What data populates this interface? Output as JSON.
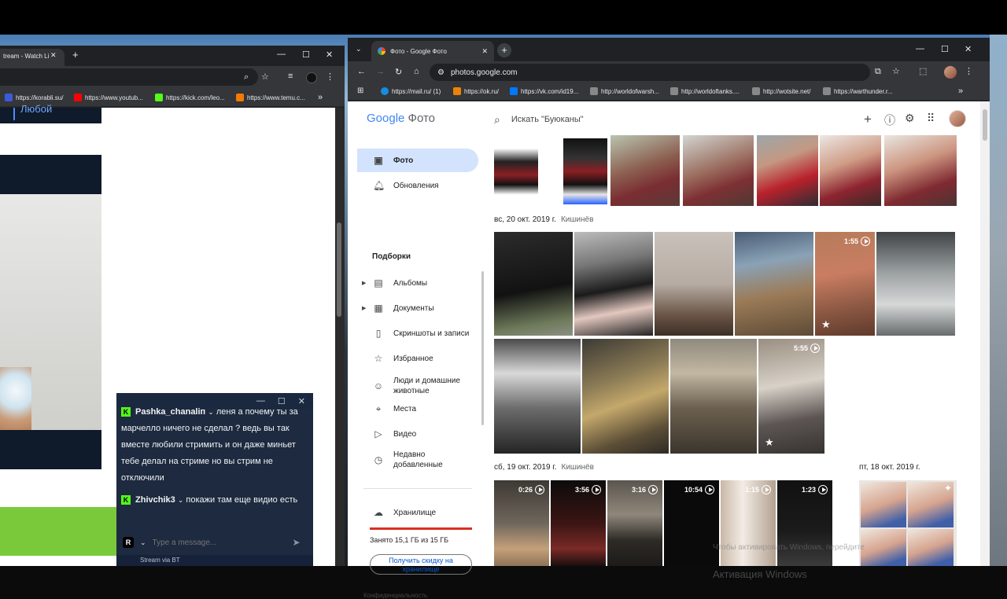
{
  "left_window": {
    "tab_title": "tream - Watch Li",
    "bookmarks": [
      {
        "label": "https://korabli.su/",
        "color": "#3b5bdb"
      },
      {
        "label": "https://www.youtub...",
        "color": "#ff0000"
      },
      {
        "label": "https://kick.com/leo...",
        "color": "#53fc18"
      },
      {
        "label": "https://www.temu.c...",
        "color": "#f27b00"
      }
    ],
    "page_fragment_text": "Любой",
    "chat": {
      "messages": [
        {
          "user": "Pashka_chanaliп",
          "text": "леня а почему ты за марчелло ничего не сделал ? ведь вы так вместе любили стримить и он даже миньет тебе делал на стриме но вы стрим не отключили"
        },
        {
          "user": "Zhivchik3",
          "text": "покажи там еще видио есть"
        }
      ],
      "input_placeholder": "Type a message...",
      "avatar_letter": "R",
      "footer_label": "Stream via BT"
    }
  },
  "right_window": {
    "tab_title": "Фото - Google Фото",
    "url": "photos.google.com",
    "bookmarks": [
      {
        "label": "https://mail.ru/ (1)",
        "color": "#168de2"
      },
      {
        "label": "https://ok.ru/",
        "color": "#ee8208"
      },
      {
        "label": "https://vk.com/id19...",
        "color": "#0077ff"
      },
      {
        "label": "http://worldofwarsh...",
        "color": "#888888"
      },
      {
        "label": "http://worldoftanks....",
        "color": "#888888"
      },
      {
        "label": "http://wotsite.net/",
        "color": "#888888"
      },
      {
        "label": "https://warthunder.r...",
        "color": "#888888"
      }
    ]
  },
  "photos_app": {
    "logo_google": "Google",
    "logo_photos": "Фото",
    "search_placeholder": "Искать \"Буюканы\"",
    "nav": [
      {
        "label": "Фото",
        "icon": "photo-icon",
        "active": true
      },
      {
        "label": "Обновления",
        "icon": "bell-icon",
        "active": false
      }
    ],
    "collections_title": "Подборки",
    "collections": [
      {
        "label": "Альбомы",
        "icon": "album-icon",
        "caret": true
      },
      {
        "label": "Документы",
        "icon": "document-icon",
        "caret": true
      },
      {
        "label": "Скриншоты и записи",
        "icon": "screenshot-icon",
        "caret": false
      },
      {
        "label": "Избранное",
        "icon": "star-icon",
        "caret": false
      },
      {
        "label": "Люди и домашние животные",
        "icon": "people-icon",
        "caret": false
      },
      {
        "label": "Места",
        "icon": "place-icon",
        "caret": false
      },
      {
        "label": "Видео",
        "icon": "video-icon",
        "caret": false
      },
      {
        "label": "Недавно добавленные",
        "icon": "recent-icon",
        "caret": false
      }
    ],
    "storage": {
      "label": "Хранилище",
      "used_text": "Занято 15,1 ГБ из 15 ГБ",
      "used_fraction": 1.0,
      "discount_button": "Получить скидку на хранилище"
    },
    "footer_link": "Конфиденциальность",
    "groups": [
      {
        "date": "вс, 20 окт. 2019 г.",
        "location": "Кишинёв"
      },
      {
        "date": "сб, 19 окт. 2019 г.",
        "location": "Кишинёв"
      },
      {
        "date": "пт, 18 окт. 2019 г.",
        "location": ""
      }
    ],
    "video_durations": {
      "row1": "1:55",
      "row2": "5:55",
      "row3": [
        "0:26",
        "3:56",
        "3:16",
        "10:54",
        "1:15",
        "1:23"
      ]
    }
  },
  "watermark": {
    "line1": "Активация Windows",
    "line2": "Чтобы активировать Windows, перейдите"
  }
}
